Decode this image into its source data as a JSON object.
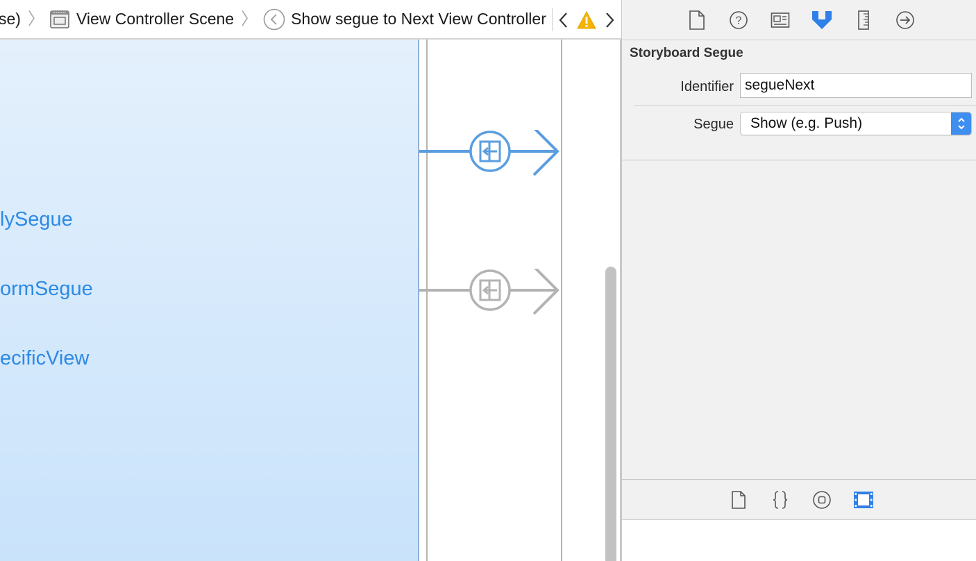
{
  "jumpbar": {
    "crumb_partial": "se)",
    "scene": "View Controller Scene",
    "segue_crumb": "Show segue to Next View Controller",
    "icons": {
      "scene": "view-controller-scene-icon",
      "segue": "segue-back-circle-icon",
      "prev": "chevron-left-icon",
      "warning": "warning-triangle-icon",
      "next": "chevron-right-icon"
    }
  },
  "canvas": {
    "outlets": [
      "lySegue",
      "ormSegue",
      "ecificView"
    ],
    "segues": [
      {
        "state": "selected",
        "color": "#5b9ee0"
      },
      {
        "state": "unselected",
        "color": "#b3b3b3"
      }
    ]
  },
  "inspector": {
    "toolbar_icons": [
      "file-inspector-icon",
      "quick-help-icon",
      "identity-inspector-icon",
      "attributes-inspector-icon",
      "size-inspector-icon",
      "connections-inspector-icon"
    ],
    "section_title": "Storyboard Segue",
    "identifier_label": "Identifier",
    "identifier_value": "segueNext",
    "segue_label": "Segue",
    "segue_value": "Show (e.g. Push)",
    "library_icons": [
      "file-template-icon",
      "code-snippet-icon",
      "object-library-icon",
      "media-library-icon"
    ]
  },
  "colors": {
    "accent": "#2f80e8",
    "outlet_text": "#2d8ae4",
    "panel_gradient_top": "#e4f0fc",
    "panel_gradient_bottom": "#c9e3fb",
    "warning": "#f5b400"
  }
}
